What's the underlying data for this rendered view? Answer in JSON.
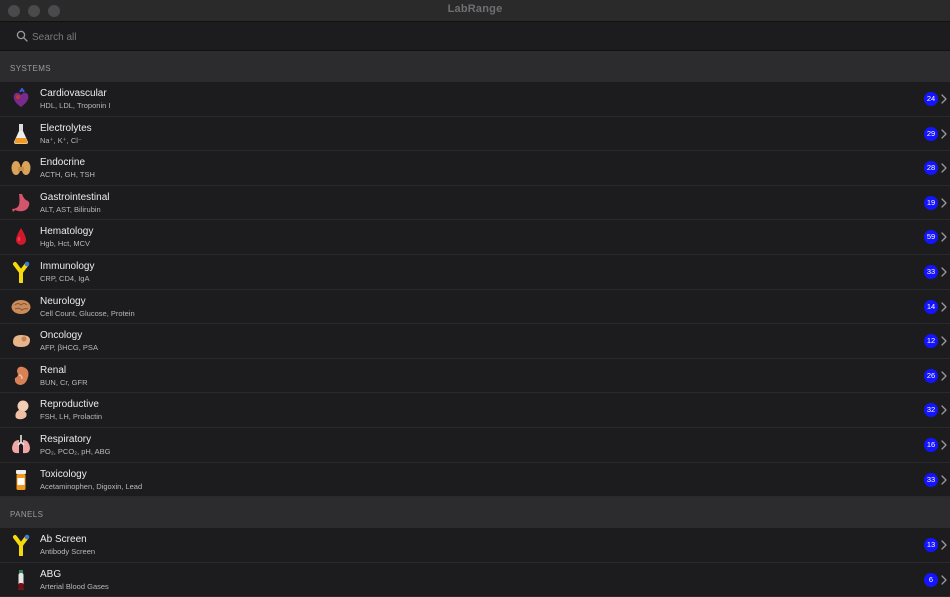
{
  "app": {
    "title": "LabRange"
  },
  "search": {
    "placeholder": "Search all"
  },
  "sections": [
    {
      "header": "SYSTEMS",
      "items": [
        {
          "title": "Cardiovascular",
          "subtitle": "HDL, LDL, Troponin I",
          "count": "24",
          "icon": "heart-icon"
        },
        {
          "title": "Electrolytes",
          "subtitle": "Na⁺, K⁺, Cl⁻",
          "count": "29",
          "icon": "flask-icon"
        },
        {
          "title": "Endocrine",
          "subtitle": "ACTH, GH, TSH",
          "count": "28",
          "icon": "thyroid-icon"
        },
        {
          "title": "Gastrointestinal",
          "subtitle": "ALT, AST, Bilirubin",
          "count": "19",
          "icon": "stomach-icon"
        },
        {
          "title": "Hematology",
          "subtitle": "Hgb, Hct, MCV",
          "count": "59",
          "icon": "blood-drop-icon"
        },
        {
          "title": "Immunology",
          "subtitle": "CRP, CD4, IgA",
          "count": "33",
          "icon": "antibody-icon"
        },
        {
          "title": "Neurology",
          "subtitle": "Cell Count, Glucose, Protein",
          "count": "14",
          "icon": "brain-icon"
        },
        {
          "title": "Oncology",
          "subtitle": "AFP, βHCG, PSA",
          "count": "12",
          "icon": "tumor-icon"
        },
        {
          "title": "Renal",
          "subtitle": "BUN, Cr, GFR",
          "count": "26",
          "icon": "kidney-icon"
        },
        {
          "title": "Reproductive",
          "subtitle": "FSH, LH, Prolactin",
          "count": "32",
          "icon": "fetus-icon"
        },
        {
          "title": "Respiratory",
          "subtitle": "PO₂, PCO₂, pH, ABG",
          "count": "16",
          "icon": "lungs-icon"
        },
        {
          "title": "Toxicology",
          "subtitle": "Acetaminophen, Digoxin, Lead",
          "count": "33",
          "icon": "pill-bottle-icon"
        }
      ]
    },
    {
      "header": "PANELS",
      "items": [
        {
          "title": "Ab Screen",
          "subtitle": "Antibody Screen",
          "count": "13",
          "icon": "antibody-icon"
        },
        {
          "title": "ABG",
          "subtitle": "Arterial Blood Gases",
          "count": "6",
          "icon": "blood-vial-icon"
        }
      ]
    }
  ],
  "colors": {
    "badge": "#1414ff",
    "background": "#1c1c1e",
    "section": "#2c2c2e"
  }
}
